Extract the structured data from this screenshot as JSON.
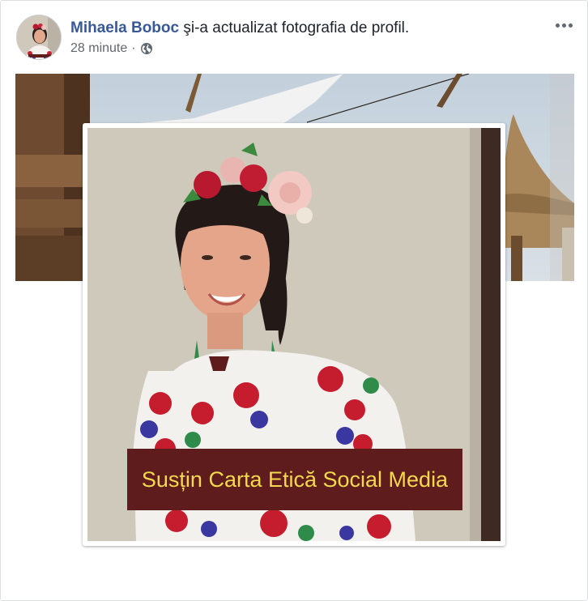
{
  "post": {
    "author_name": "Mihaela Boboc",
    "action_text": " şi-a actualizat fotografia de profil.",
    "timestamp": "28 minute",
    "separator": "·",
    "audience_icon": "globe-icon",
    "more_icon": "more-options-icon"
  },
  "profile_photo": {
    "caption": "Susțin Carta Etică Social Media",
    "caption_bg": "#5e1c1c",
    "caption_color": "#f4d84e"
  },
  "colors": {
    "author_link": "#385898",
    "meta_text": "#616770",
    "border": "#dddfe2"
  }
}
